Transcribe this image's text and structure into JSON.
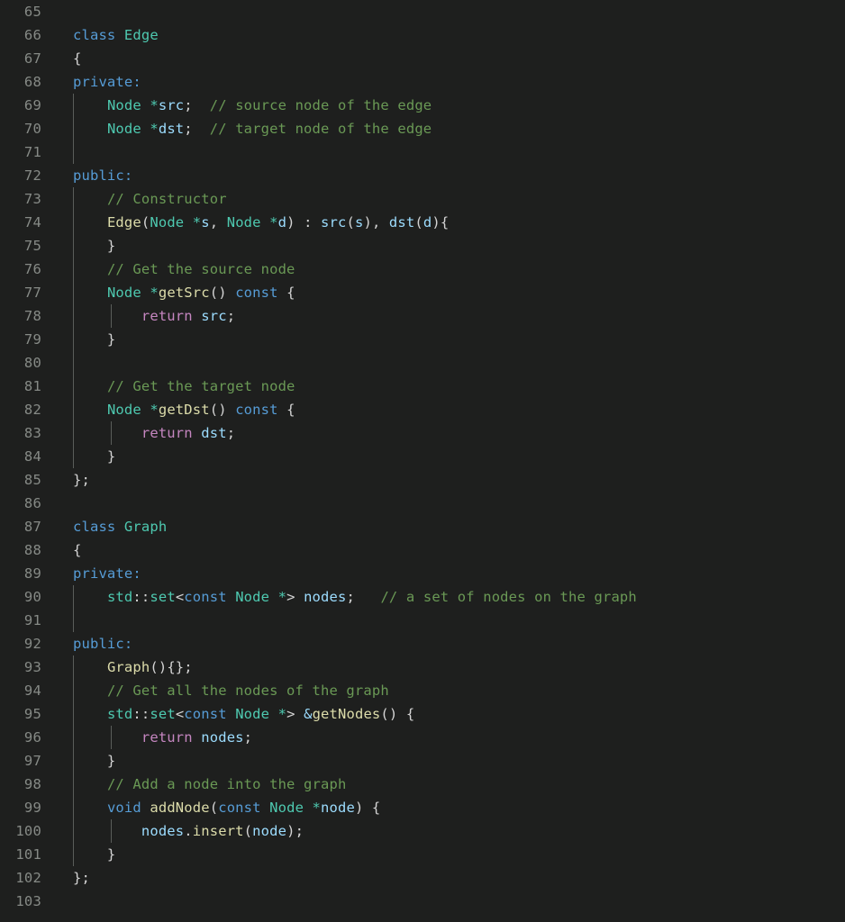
{
  "editor": {
    "language": "C++",
    "theme": "dark-plus",
    "first_line": 65,
    "last_line": 103,
    "background_color": "#1e1f1e",
    "gutter_color": "#868a86",
    "colors": {
      "keyword": "#569cd6",
      "type": "#4ec9b0",
      "function": "#dcdcaa",
      "variable": "#9cdcfe",
      "control": "#c586c0",
      "comment": "#6a9955",
      "punctuation": "#d4d4d4",
      "indent_guide": "#5a5d5a"
    }
  },
  "lines": [
    {
      "no": "65",
      "guides": [],
      "tokens": []
    },
    {
      "no": "66",
      "guides": [],
      "tokens": [
        {
          "t": "class",
          "c": "t-key"
        },
        {
          "t": " ",
          "c": "t-punc"
        },
        {
          "t": "Edge",
          "c": "t-type"
        }
      ]
    },
    {
      "no": "67",
      "guides": [],
      "tokens": [
        {
          "t": "{",
          "c": "t-punc"
        }
      ]
    },
    {
      "no": "68",
      "guides": [],
      "tokens": [
        {
          "t": "private:",
          "c": "t-key"
        }
      ]
    },
    {
      "no": "69",
      "guides": [
        "g1"
      ],
      "tokens": [
        {
          "t": "    ",
          "c": "t-punc"
        },
        {
          "t": "Node",
          "c": "t-type"
        },
        {
          "t": " ",
          "c": "t-punc"
        },
        {
          "t": "*",
          "c": "t-op"
        },
        {
          "t": "src",
          "c": "t-var"
        },
        {
          "t": ";",
          "c": "t-punc"
        },
        {
          "t": "  ",
          "c": "t-punc"
        },
        {
          "t": "// source node of the edge",
          "c": "t-comment"
        }
      ]
    },
    {
      "no": "70",
      "guides": [
        "g1"
      ],
      "tokens": [
        {
          "t": "    ",
          "c": "t-punc"
        },
        {
          "t": "Node",
          "c": "t-type"
        },
        {
          "t": " ",
          "c": "t-punc"
        },
        {
          "t": "*",
          "c": "t-op"
        },
        {
          "t": "dst",
          "c": "t-var"
        },
        {
          "t": ";",
          "c": "t-punc"
        },
        {
          "t": "  ",
          "c": "t-punc"
        },
        {
          "t": "// target node of the edge",
          "c": "t-comment"
        }
      ]
    },
    {
      "no": "71",
      "guides": [
        "g1"
      ],
      "tokens": []
    },
    {
      "no": "72",
      "guides": [],
      "tokens": [
        {
          "t": "public:",
          "c": "t-key"
        }
      ]
    },
    {
      "no": "73",
      "guides": [
        "g1"
      ],
      "tokens": [
        {
          "t": "    ",
          "c": "t-punc"
        },
        {
          "t": "// Constructor",
          "c": "t-comment"
        }
      ]
    },
    {
      "no": "74",
      "guides": [
        "g1"
      ],
      "tokens": [
        {
          "t": "    ",
          "c": "t-punc"
        },
        {
          "t": "Edge",
          "c": "t-fn"
        },
        {
          "t": "(",
          "c": "t-punc"
        },
        {
          "t": "Node",
          "c": "t-type"
        },
        {
          "t": " ",
          "c": "t-punc"
        },
        {
          "t": "*",
          "c": "t-op"
        },
        {
          "t": "s",
          "c": "t-var"
        },
        {
          "t": ", ",
          "c": "t-punc"
        },
        {
          "t": "Node",
          "c": "t-type"
        },
        {
          "t": " ",
          "c": "t-punc"
        },
        {
          "t": "*",
          "c": "t-op"
        },
        {
          "t": "d",
          "c": "t-var"
        },
        {
          "t": ") : ",
          "c": "t-punc"
        },
        {
          "t": "src",
          "c": "t-var"
        },
        {
          "t": "(",
          "c": "t-punc"
        },
        {
          "t": "s",
          "c": "t-var"
        },
        {
          "t": "), ",
          "c": "t-punc"
        },
        {
          "t": "dst",
          "c": "t-var"
        },
        {
          "t": "(",
          "c": "t-punc"
        },
        {
          "t": "d",
          "c": "t-var"
        },
        {
          "t": "){",
          "c": "t-punc"
        }
      ]
    },
    {
      "no": "75",
      "guides": [
        "g1"
      ],
      "tokens": [
        {
          "t": "    }",
          "c": "t-punc"
        }
      ]
    },
    {
      "no": "76",
      "guides": [
        "g1"
      ],
      "tokens": [
        {
          "t": "    ",
          "c": "t-punc"
        },
        {
          "t": "// Get the source node",
          "c": "t-comment"
        }
      ]
    },
    {
      "no": "77",
      "guides": [
        "g1"
      ],
      "tokens": [
        {
          "t": "    ",
          "c": "t-punc"
        },
        {
          "t": "Node",
          "c": "t-type"
        },
        {
          "t": " ",
          "c": "t-punc"
        },
        {
          "t": "*",
          "c": "t-op"
        },
        {
          "t": "getSrc",
          "c": "t-fn"
        },
        {
          "t": "() ",
          "c": "t-punc"
        },
        {
          "t": "const",
          "c": "t-key"
        },
        {
          "t": " {",
          "c": "t-punc"
        }
      ]
    },
    {
      "no": "78",
      "guides": [
        "g1",
        "g2"
      ],
      "tokens": [
        {
          "t": "        ",
          "c": "t-punc"
        },
        {
          "t": "return",
          "c": "t-ctrl"
        },
        {
          "t": " ",
          "c": "t-punc"
        },
        {
          "t": "src",
          "c": "t-var"
        },
        {
          "t": ";",
          "c": "t-punc"
        }
      ]
    },
    {
      "no": "79",
      "guides": [
        "g1"
      ],
      "tokens": [
        {
          "t": "    }",
          "c": "t-punc"
        }
      ]
    },
    {
      "no": "80",
      "guides": [
        "g1"
      ],
      "tokens": []
    },
    {
      "no": "81",
      "guides": [
        "g1"
      ],
      "tokens": [
        {
          "t": "    ",
          "c": "t-punc"
        },
        {
          "t": "// Get the target node",
          "c": "t-comment"
        }
      ]
    },
    {
      "no": "82",
      "guides": [
        "g1"
      ],
      "tokens": [
        {
          "t": "    ",
          "c": "t-punc"
        },
        {
          "t": "Node",
          "c": "t-type"
        },
        {
          "t": " ",
          "c": "t-punc"
        },
        {
          "t": "*",
          "c": "t-op"
        },
        {
          "t": "getDst",
          "c": "t-fn"
        },
        {
          "t": "() ",
          "c": "t-punc"
        },
        {
          "t": "const",
          "c": "t-key"
        },
        {
          "t": " {",
          "c": "t-punc"
        }
      ]
    },
    {
      "no": "83",
      "guides": [
        "g1",
        "g2"
      ],
      "tokens": [
        {
          "t": "        ",
          "c": "t-punc"
        },
        {
          "t": "return",
          "c": "t-ctrl"
        },
        {
          "t": " ",
          "c": "t-punc"
        },
        {
          "t": "dst",
          "c": "t-var"
        },
        {
          "t": ";",
          "c": "t-punc"
        }
      ]
    },
    {
      "no": "84",
      "guides": [
        "g1"
      ],
      "tokens": [
        {
          "t": "    }",
          "c": "t-punc"
        }
      ]
    },
    {
      "no": "85",
      "guides": [],
      "tokens": [
        {
          "t": "};",
          "c": "t-punc"
        }
      ]
    },
    {
      "no": "86",
      "guides": [],
      "tokens": []
    },
    {
      "no": "87",
      "guides": [],
      "tokens": [
        {
          "t": "class",
          "c": "t-key"
        },
        {
          "t": " ",
          "c": "t-punc"
        },
        {
          "t": "Graph",
          "c": "t-type"
        }
      ]
    },
    {
      "no": "88",
      "guides": [],
      "tokens": [
        {
          "t": "{",
          "c": "t-punc"
        }
      ]
    },
    {
      "no": "89",
      "guides": [],
      "tokens": [
        {
          "t": "private:",
          "c": "t-key"
        }
      ]
    },
    {
      "no": "90",
      "guides": [
        "g1"
      ],
      "tokens": [
        {
          "t": "    ",
          "c": "t-punc"
        },
        {
          "t": "std",
          "c": "t-type"
        },
        {
          "t": "::",
          "c": "t-punc"
        },
        {
          "t": "set",
          "c": "t-type"
        },
        {
          "t": "<",
          "c": "t-punc"
        },
        {
          "t": "const",
          "c": "t-key"
        },
        {
          "t": " ",
          "c": "t-punc"
        },
        {
          "t": "Node",
          "c": "t-type"
        },
        {
          "t": " ",
          "c": "t-punc"
        },
        {
          "t": "*",
          "c": "t-op"
        },
        {
          "t": ">",
          "c": "t-punc"
        },
        {
          "t": " ",
          "c": "t-punc"
        },
        {
          "t": "nodes",
          "c": "t-var"
        },
        {
          "t": ";",
          "c": "t-punc"
        },
        {
          "t": "   ",
          "c": "t-punc"
        },
        {
          "t": "// a set of nodes on the graph",
          "c": "t-comment"
        }
      ]
    },
    {
      "no": "91",
      "guides": [
        "g1"
      ],
      "tokens": []
    },
    {
      "no": "92",
      "guides": [],
      "tokens": [
        {
          "t": "public:",
          "c": "t-key"
        }
      ]
    },
    {
      "no": "93",
      "guides": [
        "g1"
      ],
      "tokens": [
        {
          "t": "    ",
          "c": "t-punc"
        },
        {
          "t": "Graph",
          "c": "t-fn"
        },
        {
          "t": "(){};",
          "c": "t-punc"
        }
      ]
    },
    {
      "no": "94",
      "guides": [
        "g1"
      ],
      "tokens": [
        {
          "t": "    ",
          "c": "t-punc"
        },
        {
          "t": "// Get all the nodes of the graph",
          "c": "t-comment"
        }
      ]
    },
    {
      "no": "95",
      "guides": [
        "g1"
      ],
      "tokens": [
        {
          "t": "    ",
          "c": "t-punc"
        },
        {
          "t": "std",
          "c": "t-type"
        },
        {
          "t": "::",
          "c": "t-punc"
        },
        {
          "t": "set",
          "c": "t-type"
        },
        {
          "t": "<",
          "c": "t-punc"
        },
        {
          "t": "const",
          "c": "t-key"
        },
        {
          "t": " ",
          "c": "t-punc"
        },
        {
          "t": "Node",
          "c": "t-type"
        },
        {
          "t": " ",
          "c": "t-punc"
        },
        {
          "t": "*",
          "c": "t-op"
        },
        {
          "t": ">",
          "c": "t-punc"
        },
        {
          "t": " ",
          "c": "t-punc"
        },
        {
          "t": "&",
          "c": "t-var"
        },
        {
          "t": "getNodes",
          "c": "t-fn"
        },
        {
          "t": "() {",
          "c": "t-punc"
        }
      ]
    },
    {
      "no": "96",
      "guides": [
        "g1",
        "g2"
      ],
      "tokens": [
        {
          "t": "        ",
          "c": "t-punc"
        },
        {
          "t": "return",
          "c": "t-ctrl"
        },
        {
          "t": " ",
          "c": "t-punc"
        },
        {
          "t": "nodes",
          "c": "t-var"
        },
        {
          "t": ";",
          "c": "t-punc"
        }
      ]
    },
    {
      "no": "97",
      "guides": [
        "g1"
      ],
      "tokens": [
        {
          "t": "    }",
          "c": "t-punc"
        }
      ]
    },
    {
      "no": "98",
      "guides": [
        "g1"
      ],
      "tokens": [
        {
          "t": "    ",
          "c": "t-punc"
        },
        {
          "t": "// Add a node into the graph",
          "c": "t-comment"
        }
      ]
    },
    {
      "no": "99",
      "guides": [
        "g1"
      ],
      "tokens": [
        {
          "t": "    ",
          "c": "t-punc"
        },
        {
          "t": "void",
          "c": "t-key"
        },
        {
          "t": " ",
          "c": "t-punc"
        },
        {
          "t": "addNode",
          "c": "t-fn"
        },
        {
          "t": "(",
          "c": "t-punc"
        },
        {
          "t": "const",
          "c": "t-key"
        },
        {
          "t": " ",
          "c": "t-punc"
        },
        {
          "t": "Node",
          "c": "t-type"
        },
        {
          "t": " ",
          "c": "t-punc"
        },
        {
          "t": "*",
          "c": "t-op"
        },
        {
          "t": "node",
          "c": "t-var"
        },
        {
          "t": ") {",
          "c": "t-punc"
        }
      ]
    },
    {
      "no": "100",
      "guides": [
        "g1",
        "g2"
      ],
      "tokens": [
        {
          "t": "        ",
          "c": "t-punc"
        },
        {
          "t": "nodes",
          "c": "t-var"
        },
        {
          "t": ".",
          "c": "t-punc"
        },
        {
          "t": "insert",
          "c": "t-fn"
        },
        {
          "t": "(",
          "c": "t-punc"
        },
        {
          "t": "node",
          "c": "t-var"
        },
        {
          "t": ");",
          "c": "t-punc"
        }
      ]
    },
    {
      "no": "101",
      "guides": [
        "g1"
      ],
      "tokens": [
        {
          "t": "    }",
          "c": "t-punc"
        }
      ]
    },
    {
      "no": "102",
      "guides": [],
      "tokens": [
        {
          "t": "};",
          "c": "t-punc"
        }
      ]
    },
    {
      "no": "103",
      "guides": [],
      "tokens": []
    }
  ]
}
